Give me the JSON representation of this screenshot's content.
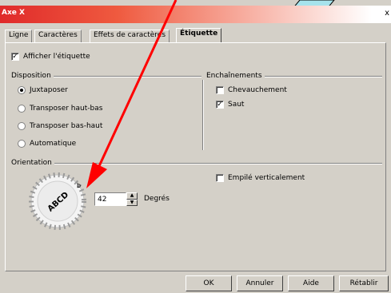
{
  "window": {
    "title": "Axe X",
    "close_glyph": "x"
  },
  "tabs": [
    {
      "label": "Ligne",
      "active": false
    },
    {
      "label": "Caractères",
      "active": false
    },
    {
      "label": "Effets de caractères",
      "active": false
    },
    {
      "label": "Étiquette",
      "active": true
    }
  ],
  "show_label": {
    "label": "Afficher l'étiquette",
    "checked": true
  },
  "disposition": {
    "title": "Disposition",
    "options": [
      {
        "label": "Juxtaposer",
        "selected": true
      },
      {
        "label": "Transposer haut-bas",
        "selected": false
      },
      {
        "label": "Transposer bas-haut",
        "selected": false
      },
      {
        "label": "Automatique",
        "selected": false
      }
    ]
  },
  "enchainements": {
    "title": "Enchaînements",
    "options": [
      {
        "label": "Chevauchement",
        "checked": false
      },
      {
        "label": "Saut",
        "checked": true
      }
    ]
  },
  "orientation": {
    "title": "Orientation",
    "dial_text": "ABCD",
    "dial_small": "b",
    "degrees_value": "42",
    "degrees_label": "Degrés",
    "stacked": {
      "label": "Empilé verticalement",
      "checked": false
    }
  },
  "buttons": {
    "ok": "OK",
    "cancel": "Annuler",
    "help": "Aide",
    "reset": "Rétablir"
  },
  "colors": {
    "annotation_arrow": "#ff0000",
    "titlebar": "#e02a2a",
    "dialog_bg": "#d4d0c8"
  }
}
